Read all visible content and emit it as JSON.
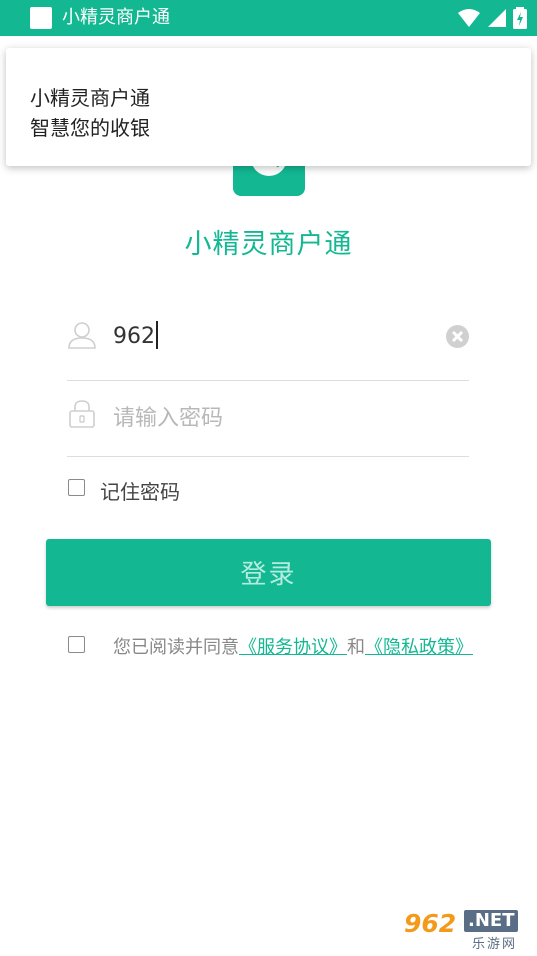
{
  "status_bar": {
    "app_title": "小精灵商户通"
  },
  "notification": {
    "line1": "小精灵商户通",
    "line2": "智慧您的收银"
  },
  "app": {
    "title": "小精灵商户通"
  },
  "login_form": {
    "username_value": "962",
    "password_placeholder": "请输入密码",
    "remember_label": "记住密码",
    "login_button": "登录"
  },
  "agreement": {
    "prefix": "您已阅读并同意",
    "service_link": "《服务协议》",
    "connector": "和",
    "privacy_link": "《隐私政策》"
  },
  "watermark": {
    "number": "962",
    "domain": ".NET",
    "subtitle": "乐游网"
  },
  "colors": {
    "accent": "#13b893",
    "button_text": "#b5ece0",
    "placeholder": "#b8b8b8"
  }
}
